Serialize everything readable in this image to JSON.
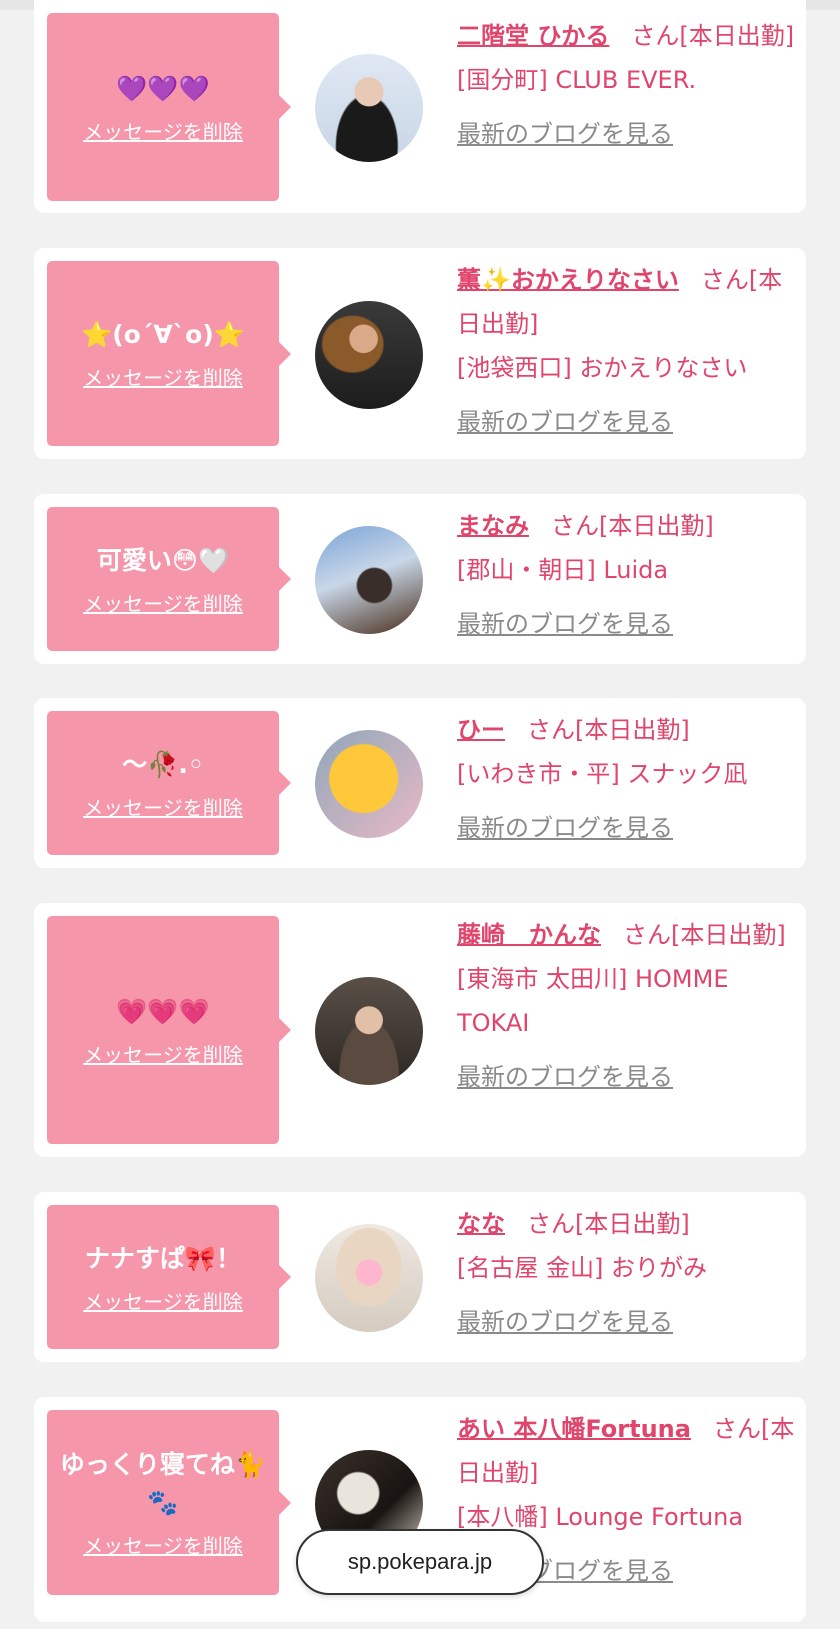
{
  "site_url": "sp.pokepara.jp",
  "delete_label": "メッセージを削除",
  "san_suffix": "さん",
  "blog_label": "最新のブログを見る",
  "cards": [
    {
      "message": "💜💜💜",
      "name": "二階堂 ひかる",
      "status": "[本日出勤]",
      "shop": "[国分町] CLUB EVER."
    },
    {
      "message": "⭐(o´∀`o)⭐",
      "name": "薫✨おかえりなさい",
      "status": "[本日出勤]",
      "shop": "[池袋西口] おかえりなさい"
    },
    {
      "message": "可愛い😳🤍",
      "name": "まなみ",
      "status": "[本日出勤]",
      "shop": "[郡山・朝日] Luida"
    },
    {
      "message": "〜🥀.◦",
      "name": "ひー",
      "status": "[本日出勤]",
      "shop": "[いわき市・平] スナック凪"
    },
    {
      "message": "💗💗💗",
      "name": "藤崎　かんな",
      "status": "[本日出勤]",
      "shop": "[東海市 太田川] HOMME TOKAI"
    },
    {
      "message": "ナナすぱ🎀！",
      "name": "なな",
      "status": "[本日出勤]",
      "shop": "[名古屋 金山] おりがみ"
    },
    {
      "message": "ゆっくり寝てね🐈🐾",
      "name": "あい 本八幡Fortuna",
      "status": "[本日出勤]",
      "shop": "[本八幡] Lounge Fortuna"
    }
  ],
  "colors": {
    "accent": "#e0456c",
    "bubble": "#f696aa",
    "background": "#f1f1f1"
  }
}
